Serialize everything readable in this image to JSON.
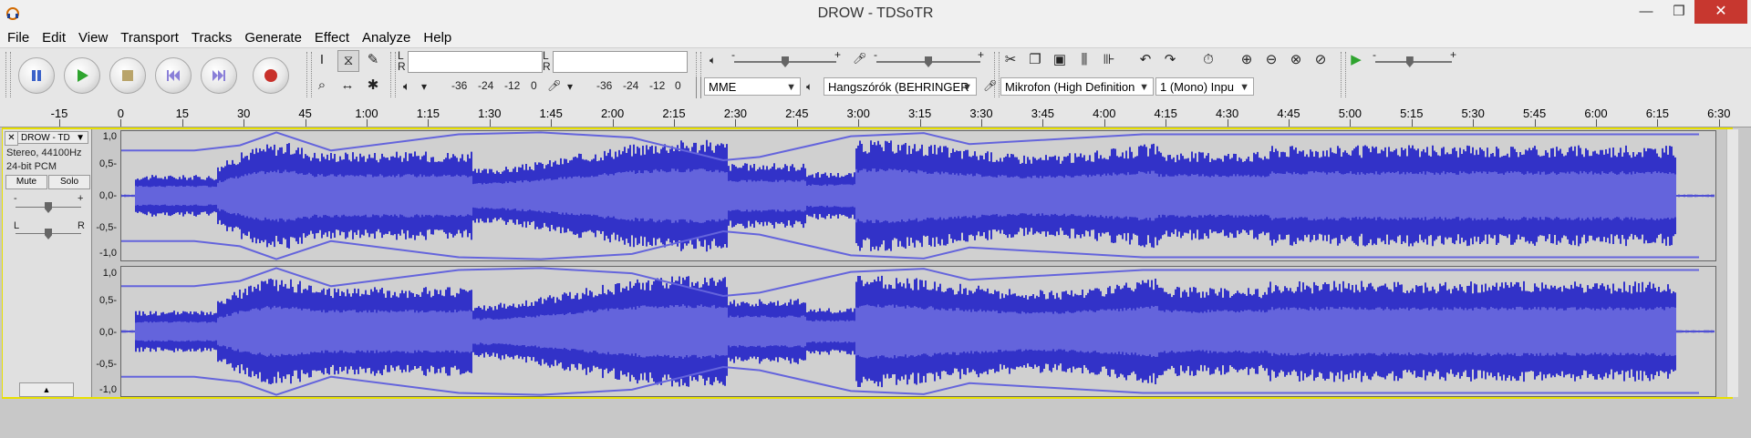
{
  "window": {
    "title": "DROW - TDSoTR",
    "minimize": "—",
    "maximize": "❒",
    "close": "✕"
  },
  "menu": [
    "File",
    "Edit",
    "View",
    "Transport",
    "Tracks",
    "Generate",
    "Effect",
    "Analyze",
    "Help"
  ],
  "transport": {
    "buttons": [
      "pause-icon",
      "play-icon",
      "stop-icon",
      "skip-start-icon",
      "skip-end-icon",
      "record-icon"
    ]
  },
  "meters": {
    "play_l": "L",
    "play_r": "R",
    "rec_l": "L",
    "rec_r": "R",
    "play_scale": [
      "-36",
      "-24",
      "-12",
      "0"
    ],
    "rec_scale": [
      "-36",
      "-24",
      "-12",
      "0"
    ]
  },
  "mixer": {
    "out_minus": "-",
    "out_plus": "+",
    "in_minus": "-",
    "in_plus": "+",
    "out_level": 0.5,
    "in_level": 0.5
  },
  "play_at_speed": {
    "minus": "-",
    "plus": "+",
    "level": 0.45
  },
  "device": {
    "host": "MME",
    "output": "Hangszórók (BEHRINGER",
    "input": "Mikrofon (High Definition",
    "channels": "1 (Mono) Inpu"
  },
  "ruler": {
    "ticks": [
      "-15",
      "0",
      "15",
      "30",
      "45",
      "1:00",
      "1:15",
      "1:30",
      "1:45",
      "2:00",
      "2:15",
      "2:30",
      "2:45",
      "3:00",
      "3:15",
      "3:30",
      "3:45",
      "4:00",
      "4:15",
      "4:30",
      "4:45",
      "5:00",
      "5:15",
      "5:30",
      "5:45",
      "6:00",
      "6:15",
      "6:30"
    ]
  },
  "track": {
    "name": "DROW - TD",
    "close": "✕",
    "menu_arrow": "▼",
    "format": "Stereo, 44100Hz",
    "bits": "24-bit PCM",
    "mute": "Mute",
    "solo": "Solo",
    "gain_minus": "-",
    "gain_plus": "+",
    "pan_left": "L",
    "pan_right": "R",
    "gain_level": 0.5,
    "pan_level": 0.5,
    "collapse": "▲",
    "scale": [
      "1,0",
      "0,5-",
      "0,0-",
      "-0,5-",
      "-1,0"
    ],
    "wave_color": "#3232c8",
    "envelope_color": "#6464dc"
  }
}
